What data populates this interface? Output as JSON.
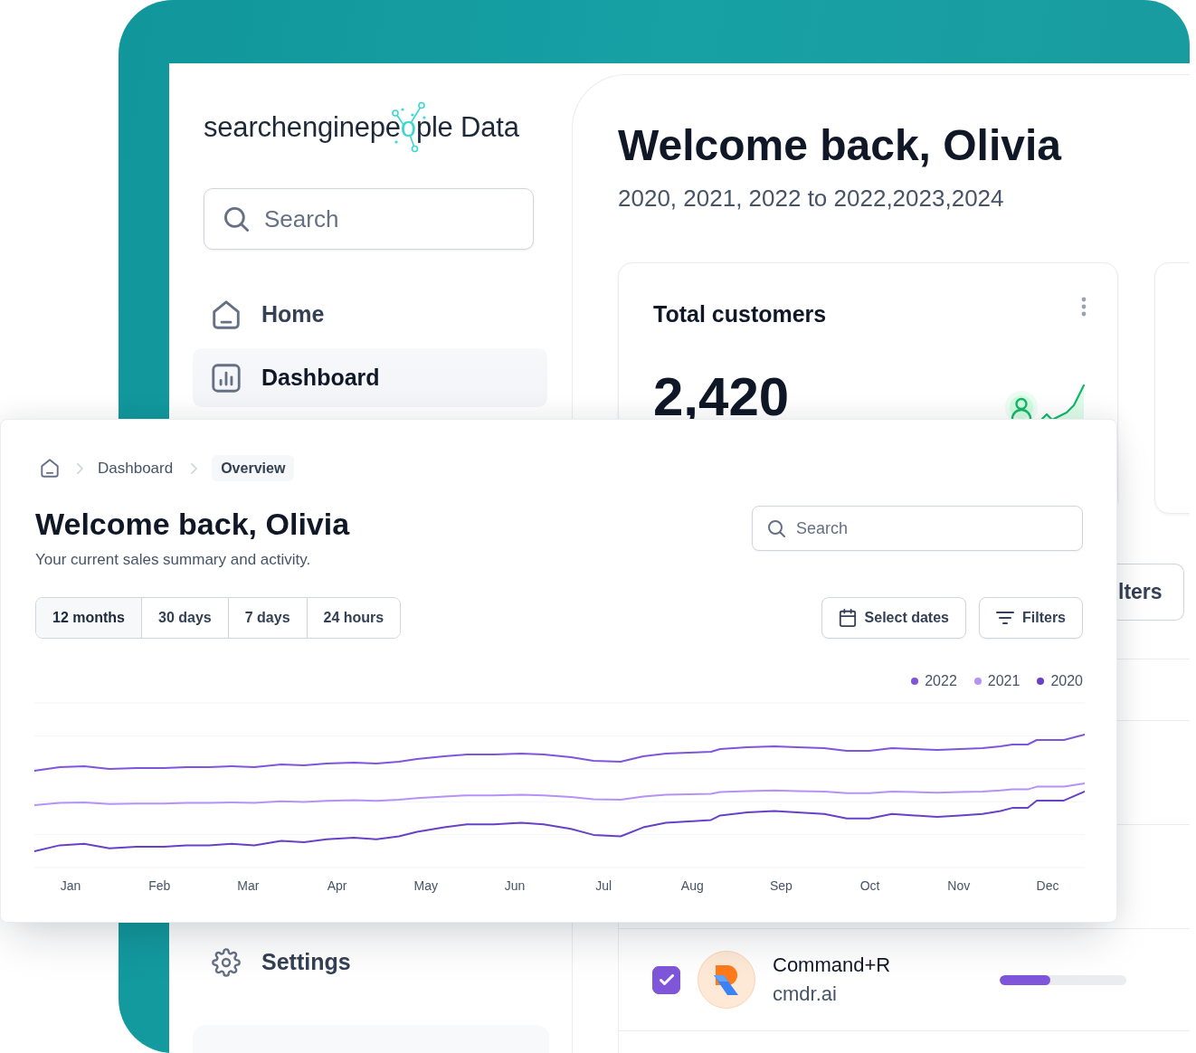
{
  "logo": {
    "wordmark": [
      "searchenginepe",
      "o",
      "ple Data"
    ]
  },
  "sidebar": {
    "search": {
      "placeholder": "Search"
    },
    "nav_top": [
      {
        "label": "Home",
        "selected": false
      },
      {
        "label": "Dashboard",
        "selected": true
      }
    ],
    "nav_bottom": [
      {
        "label": "Settings",
        "selected": false
      }
    ]
  },
  "main": {
    "title": "Welcome back, Olivia",
    "subtitle": "2020, 2021, 2022 to 2022,2023,2024",
    "stat_card": {
      "title": "Total customers",
      "value": "2,420"
    },
    "filters_button": "lters",
    "rows": [
      {
        "checked": true,
        "name": "Command+R",
        "domain": "cmdr.ai",
        "level": 0.4
      }
    ]
  },
  "overview": {
    "breadcrumb": [
      {
        "label": "Dashboard",
        "selected": false
      },
      {
        "label": "Overview",
        "selected": true
      }
    ],
    "title": "Welcome back, Olivia",
    "subtitle": "Your current sales summary and activity.",
    "search": {
      "placeholder": "Search"
    },
    "ranges": [
      {
        "label": "12 months",
        "selected": true
      },
      {
        "label": "30 days",
        "selected": false
      },
      {
        "label": "7 days",
        "selected": false
      },
      {
        "label": "24 hours",
        "selected": false
      }
    ],
    "buttons": [
      "Select dates",
      "Filters"
    ],
    "legend": [
      {
        "label": "2022",
        "color": "#7f56d9"
      },
      {
        "label": "2021",
        "color": "#b692f6"
      },
      {
        "label": "2020",
        "color": "#6941c6"
      }
    ],
    "months": [
      "Jan",
      "Feb",
      "Mar",
      "Apr",
      "May",
      "Jun",
      "Jul",
      "Aug",
      "Sep",
      "Oct",
      "Nov",
      "Dec"
    ]
  }
}
